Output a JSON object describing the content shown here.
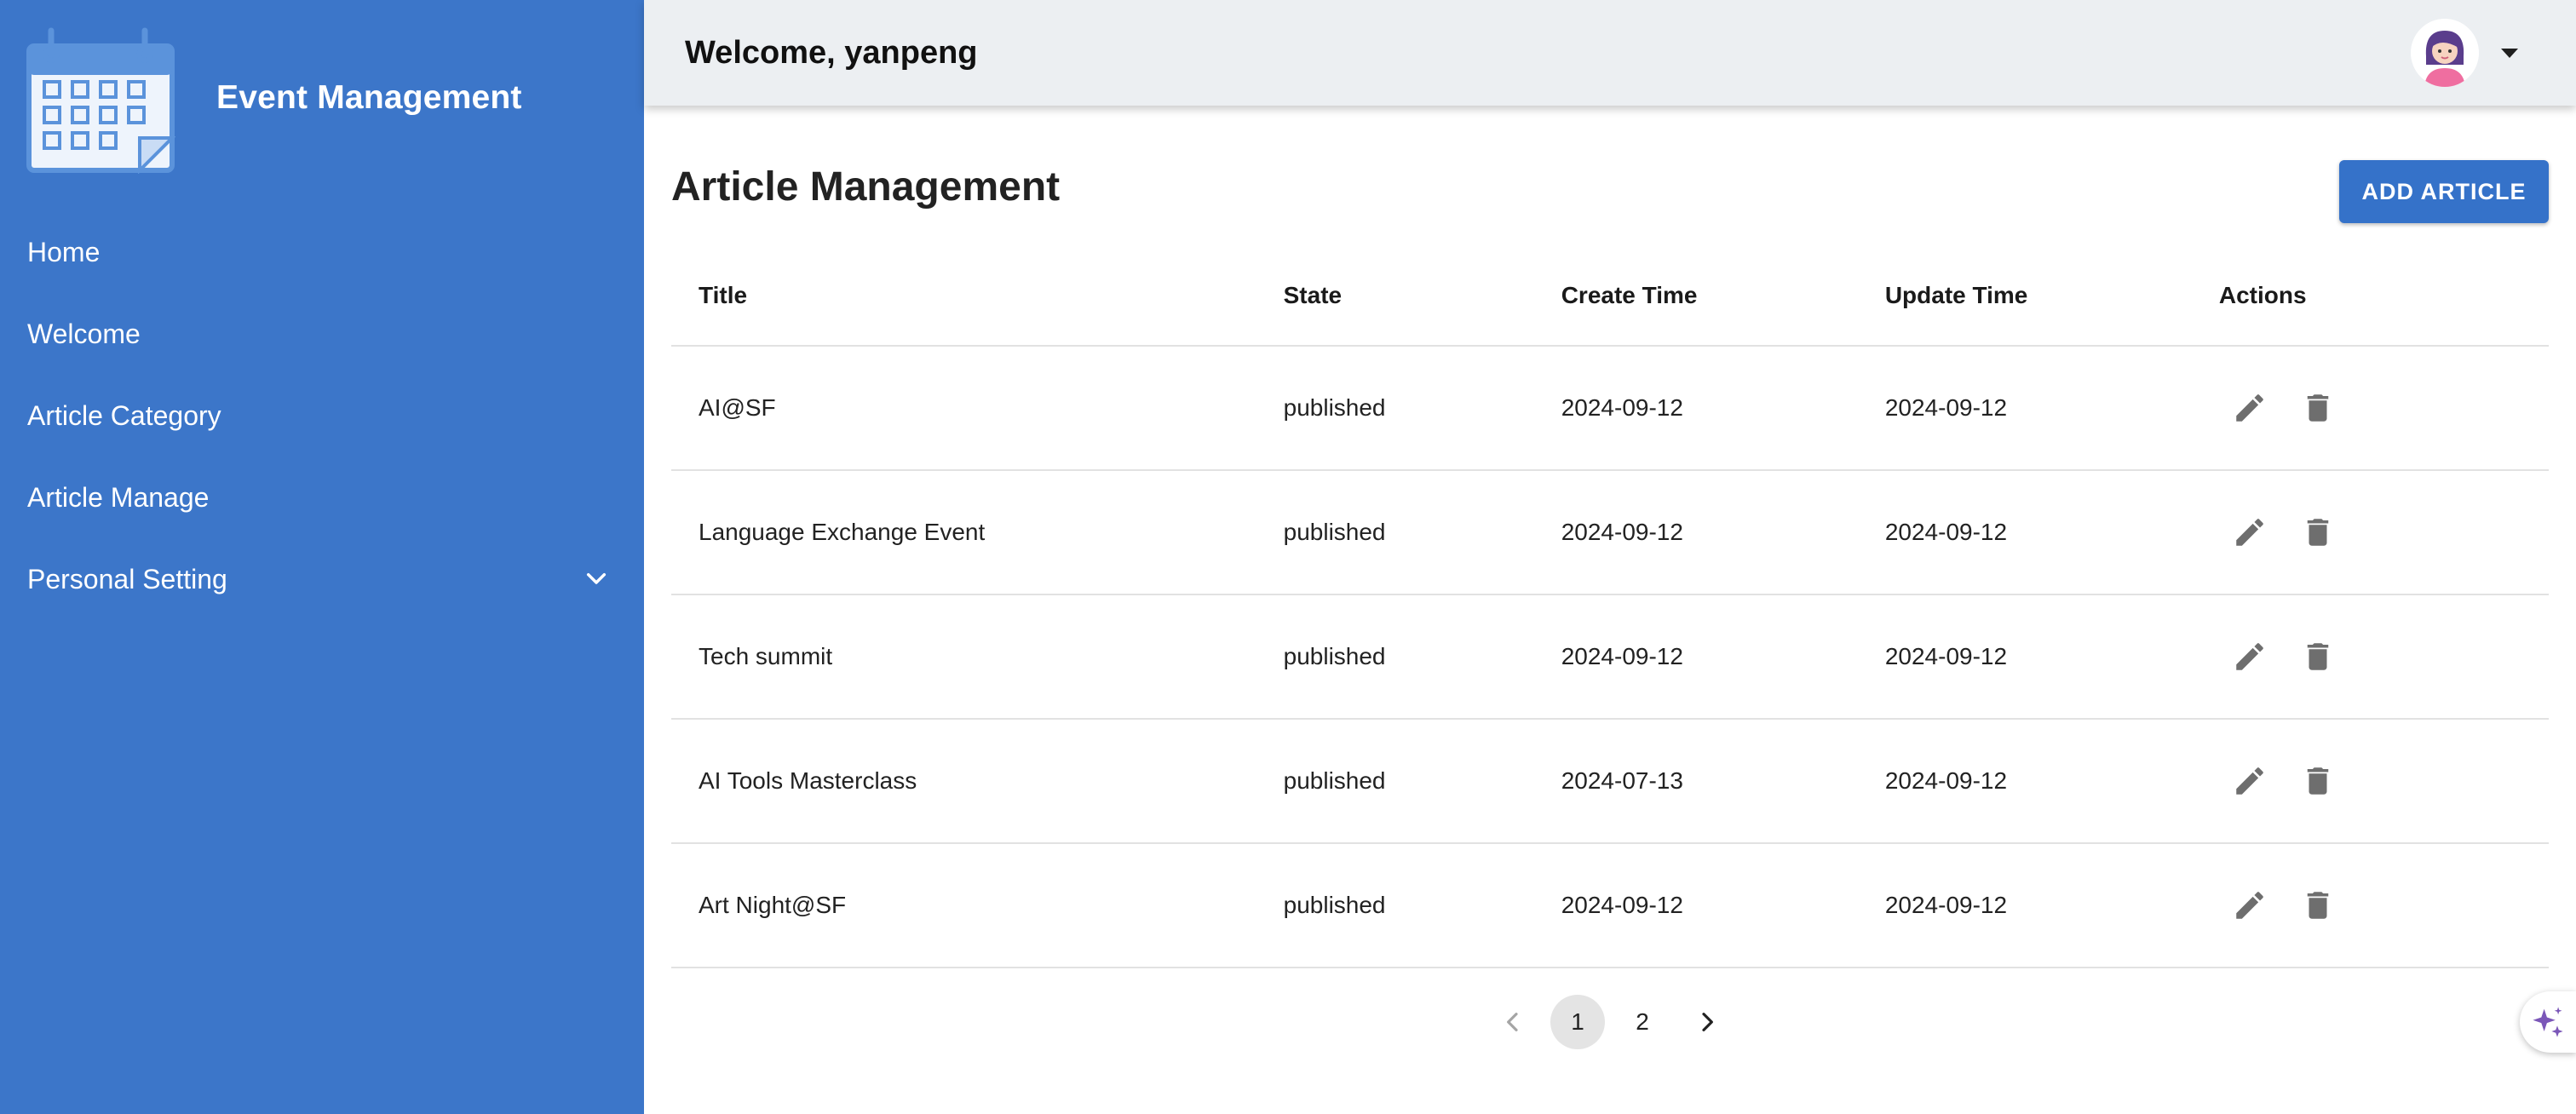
{
  "sidebar": {
    "brand": "Event Management",
    "items": [
      {
        "label": "Home"
      },
      {
        "label": "Welcome"
      },
      {
        "label": "Article Category"
      },
      {
        "label": "Article Manage"
      },
      {
        "label": "Personal Setting"
      }
    ],
    "color": "#3c76c9"
  },
  "header": {
    "welcome": "Welcome, yanpeng",
    "avatar_icon": "user-avatar-icon",
    "caret_icon": "caret-down-icon"
  },
  "main": {
    "title": "Article Management",
    "add_button": "ADD ARTICLE",
    "accent": "#3572c9",
    "columns": [
      "Title",
      "State",
      "Create Time",
      "Update Time",
      "Actions"
    ],
    "rows": [
      {
        "title": "AI@SF",
        "state": "published",
        "create": "2024-09-12",
        "update": "2024-09-12"
      },
      {
        "title": "Language Exchange Event",
        "state": "published",
        "create": "2024-09-12",
        "update": "2024-09-12"
      },
      {
        "title": "Tech summit",
        "state": "published",
        "create": "2024-09-12",
        "update": "2024-09-12"
      },
      {
        "title": "AI Tools Masterclass",
        "state": "published",
        "create": "2024-07-13",
        "update": "2024-09-12"
      },
      {
        "title": "Art Night@SF",
        "state": "published",
        "create": "2024-09-12",
        "update": "2024-09-12"
      }
    ],
    "pagination": {
      "pages": [
        "1",
        "2"
      ],
      "current": "1"
    }
  }
}
